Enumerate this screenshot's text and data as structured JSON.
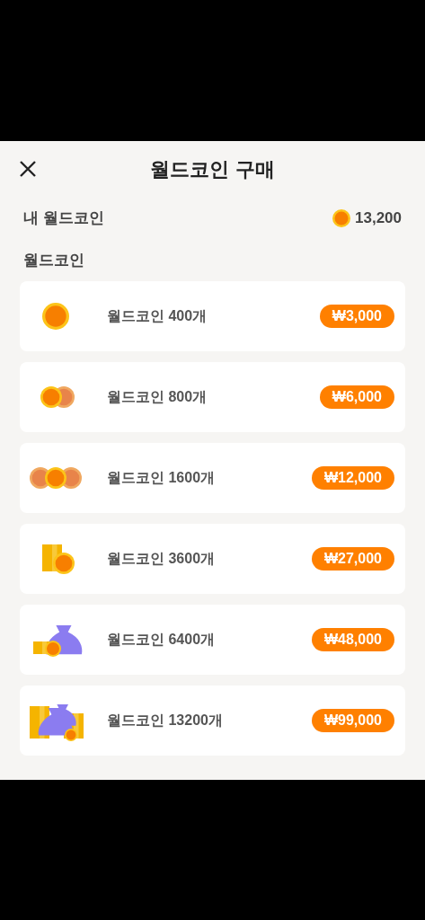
{
  "header": {
    "title": "월드코인 구매"
  },
  "balance": {
    "label": "내 월드코인",
    "amount": "13,200"
  },
  "section_title": "월드코인",
  "packages": [
    {
      "kind": "coin1",
      "name": "월드코인 400개",
      "price": "₩3,000"
    },
    {
      "kind": "coin2",
      "name": "월드코인 800개",
      "price": "₩6,000"
    },
    {
      "kind": "coin3",
      "name": "월드코인 1600개",
      "price": "₩12,000"
    },
    {
      "kind": "stack",
      "name": "월드코인 3600개",
      "price": "₩27,000"
    },
    {
      "kind": "bag",
      "name": "월드코인 6400개",
      "price": "₩48,000"
    },
    {
      "kind": "bags",
      "name": "월드코인 13200개",
      "price": "₩99,000"
    }
  ]
}
